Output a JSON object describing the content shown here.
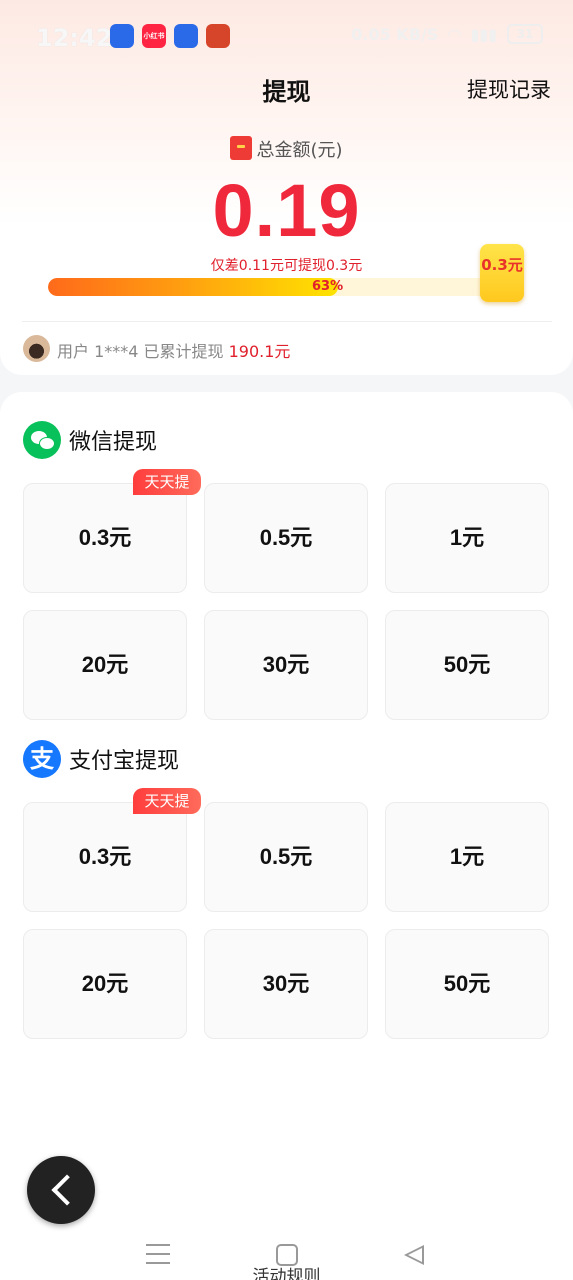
{
  "status_bar": {
    "time": "12:42",
    "apps": [
      {
        "name": "baidu-app-icon",
        "color": "#2a6ae8",
        "label": ""
      },
      {
        "name": "xiaohongshu-app-icon",
        "color": "#ff2442",
        "label": "小红书"
      },
      {
        "name": "browser-app-icon",
        "color": "#2a6ae8",
        "label": ""
      },
      {
        "name": "game-app-icon",
        "color": "#d6452a",
        "label": ""
      }
    ],
    "network_speed": "0.05 KB/S",
    "battery": "31"
  },
  "header": {
    "title": "提现",
    "record_link": "提现记录"
  },
  "summary": {
    "total_label": "总金额(元)",
    "amount": "0.19",
    "gap_text": "仅差0.11元可提现0.3元",
    "progress_percent": 63,
    "progress_label": "63%",
    "goal_label": "0.3元"
  },
  "user_line": {
    "prefix": "用户 1***4 已累计提现 ",
    "amount": "190.1元"
  },
  "wechat": {
    "title": "微信提现",
    "tag": "天天提",
    "options": [
      "0.3元",
      "0.5元",
      "1元",
      "20元",
      "30元",
      "50元"
    ]
  },
  "alipay": {
    "title": "支付宝提现",
    "icon_glyph": "支",
    "tag": "天天提",
    "options": [
      "0.3元",
      "0.5元",
      "1元",
      "20元",
      "30元",
      "50元"
    ]
  },
  "footer": {
    "rules_label": "活动规则"
  },
  "colors": {
    "accent_red": "#f0283c",
    "wechat_green": "#09c15a",
    "alipay_blue": "#1677ff"
  }
}
